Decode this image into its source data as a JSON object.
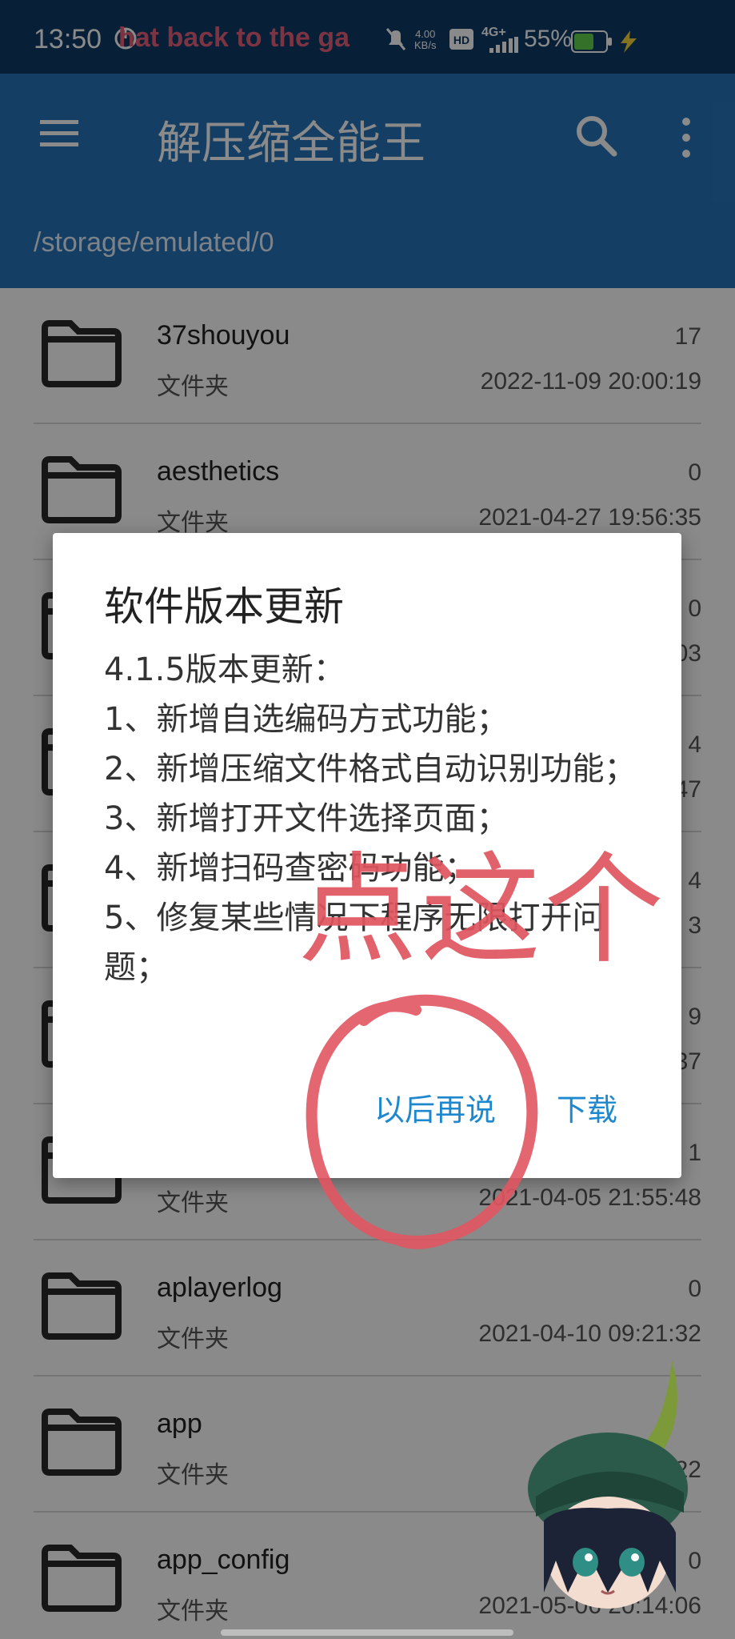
{
  "status_bar": {
    "time": "13:50",
    "marquee": "hat back to the ga",
    "speed_value": "4.00",
    "speed_unit": "KB/s",
    "hd_label": "HD",
    "network": "4G+",
    "battery": "55%"
  },
  "app_bar": {
    "title": "解压缩全能王",
    "path": "/storage/emulated/0"
  },
  "files": [
    {
      "name": "37shouyou",
      "type": "文件夹",
      "count": "17",
      "date": "2022-11-09 20:00:19"
    },
    {
      "name": "aesthetics",
      "type": "文件夹",
      "count": "0",
      "date": "2021-04-27 19:56:35"
    },
    {
      "name": "",
      "type": "",
      "count": "0",
      "date": "03"
    },
    {
      "name": "",
      "type": "",
      "count": "4",
      "date": "47"
    },
    {
      "name": "",
      "type": "",
      "count": "4",
      "date": "3"
    },
    {
      "name": "",
      "type": "",
      "count": "9",
      "date": "37"
    },
    {
      "name": "",
      "type": "文件夹",
      "count": "1",
      "date": "2021-04-05 21:55:48"
    },
    {
      "name": "aplayerlog",
      "type": "文件夹",
      "count": "0",
      "date": "2021-04-10 09:21:32"
    },
    {
      "name": "app",
      "type": "文件夹",
      "count": "",
      "date": "2022"
    },
    {
      "name": "app_config",
      "type": "文件夹",
      "count": "0",
      "date": "2021-05-06 20:14:06"
    }
  ],
  "dialog": {
    "title": "软件版本更新",
    "lines": [
      "4.1.5版本更新：",
      "1、新增自选编码方式功能；",
      "2、新增压缩文件格式自动识别功能；",
      "3、新增打开文件选择页面；",
      "4、新增扫码查密码功能；",
      "5、修复某些情况下程序无限打开问题；"
    ],
    "later_label": "以后再说",
    "download_label": "下载"
  },
  "annotation": {
    "text": "点这个",
    "color": "#e05560"
  },
  "colors": {
    "status_bar": "#0e3b66",
    "app_bar": "#2674b8",
    "dialog_button": "#1e88cf"
  }
}
